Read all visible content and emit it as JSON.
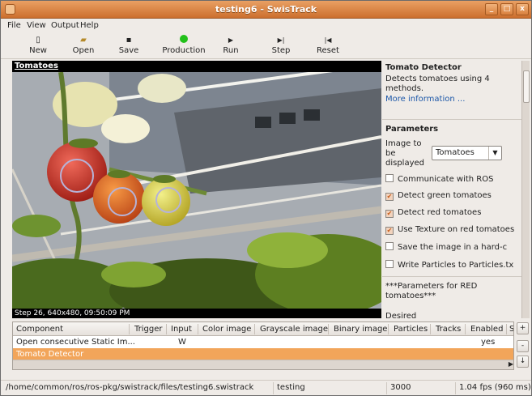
{
  "window": {
    "title": "testing6 - SwisTrack",
    "buttons": [
      "_",
      "□",
      "x"
    ]
  },
  "menu": [
    "File",
    "View",
    "Output",
    "Help"
  ],
  "toolbar": {
    "items": [
      {
        "label": "New",
        "icon": "new-file-icon"
      },
      {
        "label": "Open",
        "icon": "open-folder-icon"
      },
      {
        "label": "Save",
        "icon": "save-disk-icon"
      },
      {
        "label": "Production",
        "icon": "production-status-icon",
        "color": "#22c01a"
      },
      {
        "label": "Run",
        "icon": "run-play-icon"
      },
      {
        "label": "Step",
        "icon": "step-icon"
      },
      {
        "label": "Reset",
        "icon": "reset-icon"
      }
    ],
    "glyphs": {
      "new": "▯",
      "open": "▰",
      "save": "▪",
      "run": "▶",
      "step": "▶|",
      "reset": "|◀"
    }
  },
  "video": {
    "title": "Tomatoes",
    "status": "Step 26, 640x480, 09:50:09 PM"
  },
  "detector": {
    "title": "Tomato Detector",
    "description": "Detects tomatoes using 4 methods.",
    "more_info": "More information ...",
    "parameters_title": "Parameters",
    "image_label": "Image to be displayed",
    "image_value": "Tomatoes",
    "options": [
      {
        "label": "Communicate with ROS",
        "checked": false
      },
      {
        "label": "Detect green tomatoes",
        "checked": true
      },
      {
        "label": "Detect red tomatoes",
        "checked": true
      },
      {
        "label": "Use Texture on red tomatoes",
        "checked": true
      },
      {
        "label": "Save the image in a hard-c",
        "checked": false
      },
      {
        "label": "Write Particles to Particles.tx",
        "checked": false
      }
    ],
    "red_params": "***Parameters for RED tomatoes***",
    "desired": "Desired"
  },
  "table": {
    "columns": [
      "Component",
      "Trigger",
      "Input",
      "Color image",
      "Grayscale image",
      "Binary image",
      "Particles",
      "Tracks",
      "Enabled",
      "S"
    ],
    "rows": [
      {
        "component": "Open consecutive Static Im...",
        "trigger": "",
        "input": "W",
        "enabled": "yes",
        "selected": false
      },
      {
        "component": "Tomato Detector",
        "trigger": "",
        "input": "",
        "enabled": "",
        "selected": true
      }
    ],
    "side_buttons": [
      "+",
      "-",
      "↓"
    ]
  },
  "statusbar": {
    "path": "/home/common/ros/ros-pkg/swistrack/files/testing6.swistrack",
    "mode": "testing",
    "port": "3000",
    "fps": "1.04 fps (960 ms)"
  }
}
